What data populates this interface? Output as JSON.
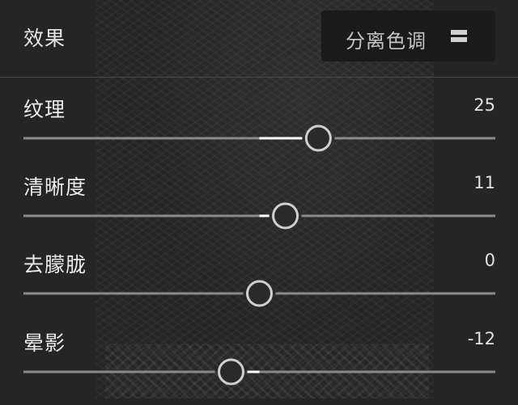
{
  "panel": {
    "title": "效果",
    "split_toning_button": {
      "label": "分离色调",
      "icon": "panel-toggle-icon"
    }
  },
  "colors": {
    "background": "#252525",
    "track": "#8a8a8a",
    "fill": "#ffffff",
    "knob_ring": "#cfcfcf"
  },
  "sliders": [
    {
      "id": "texture",
      "label": "纹理",
      "value": 25,
      "value_text": "25",
      "min": -100,
      "max": 100
    },
    {
      "id": "clarity",
      "label": "清晰度",
      "value": 11,
      "value_text": "11",
      "min": -100,
      "max": 100
    },
    {
      "id": "dehaze",
      "label": "去朦胧",
      "value": 0,
      "value_text": "0",
      "min": -100,
      "max": 100
    },
    {
      "id": "vignette",
      "label": "晕影",
      "value": -12,
      "value_text": "-12",
      "min": -100,
      "max": 100
    }
  ]
}
